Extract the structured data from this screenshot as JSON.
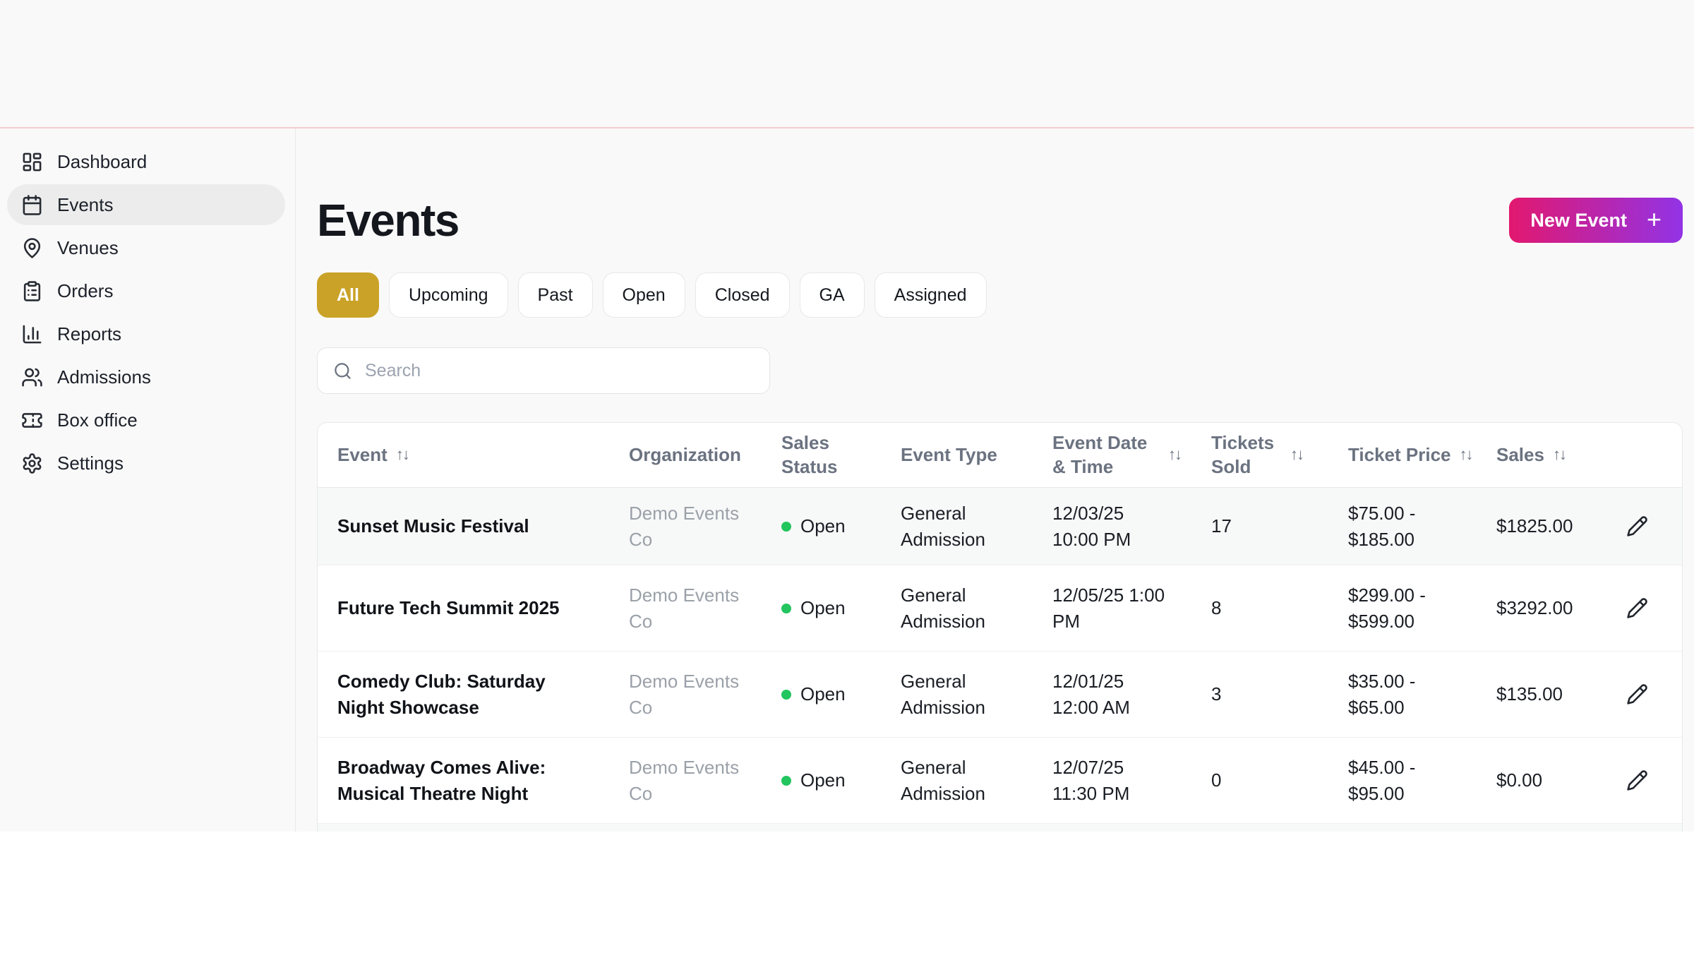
{
  "colors": {
    "gold": "#c9a227",
    "gradient_start": "#e2186f",
    "gradient_end": "#9233e6",
    "status_open": "#22c55e",
    "top_line": "#f4cdcd"
  },
  "sidebar": {
    "items": [
      {
        "label": "Dashboard"
      },
      {
        "label": "Events"
      },
      {
        "label": "Venues"
      },
      {
        "label": "Orders"
      },
      {
        "label": "Reports"
      },
      {
        "label": "Admissions"
      },
      {
        "label": "Box office"
      },
      {
        "label": "Settings"
      }
    ],
    "active_item": "Events"
  },
  "page": {
    "title": "Events"
  },
  "toolbar": {
    "new_event_label": "New Event",
    "plus_icon": "+"
  },
  "filters": {
    "chips": [
      "All",
      "Upcoming",
      "Past",
      "Open",
      "Closed",
      "GA",
      "Assigned"
    ],
    "active": "All"
  },
  "search": {
    "placeholder": "Search"
  },
  "icons": {
    "sort": "↑↓"
  },
  "table": {
    "columns": [
      {
        "label": "Event",
        "sortable": true
      },
      {
        "label": "Organization",
        "sortable": false
      },
      {
        "label": "Sales Status",
        "sortable": false
      },
      {
        "label": "Event Type",
        "sortable": false
      },
      {
        "label": "Event Date & Time",
        "sortable": true
      },
      {
        "label": "Tickets Sold",
        "sortable": true
      },
      {
        "label": "Ticket Price",
        "sortable": true
      },
      {
        "label": "Sales",
        "sortable": true
      }
    ],
    "rows": [
      {
        "event": "Sunset Music Festival",
        "organization": "Demo Events Co",
        "sales_status": "Open",
        "event_type": "General Admission",
        "datetime": "12/03/25 10:00 PM",
        "tickets_sold": "17",
        "ticket_price": "$75.00 - $185.00",
        "sales": "$1825.00"
      },
      {
        "event": "Future Tech Summit 2025",
        "organization": "Demo Events Co",
        "sales_status": "Open",
        "event_type": "General Admission",
        "datetime": "12/05/25 1:00 PM",
        "tickets_sold": "8",
        "ticket_price": "$299.00 - $599.00",
        "sales": "$3292.00"
      },
      {
        "event": "Comedy Club: Saturday Night Showcase",
        "organization": "Demo Events Co",
        "sales_status": "Open",
        "event_type": "General Admission",
        "datetime": "12/01/25 12:00 AM",
        "tickets_sold": "3",
        "ticket_price": "$35.00 - $65.00",
        "sales": "$135.00"
      },
      {
        "event": "Broadway Comes Alive: Musical Theatre Night",
        "organization": "Demo Events Co",
        "sales_status": "Open",
        "event_type": "General Admission",
        "datetime": "12/07/25 11:30 PM",
        "tickets_sold": "0",
        "ticket_price": "$45.00 - $95.00",
        "sales": "$0.00"
      }
    ]
  }
}
